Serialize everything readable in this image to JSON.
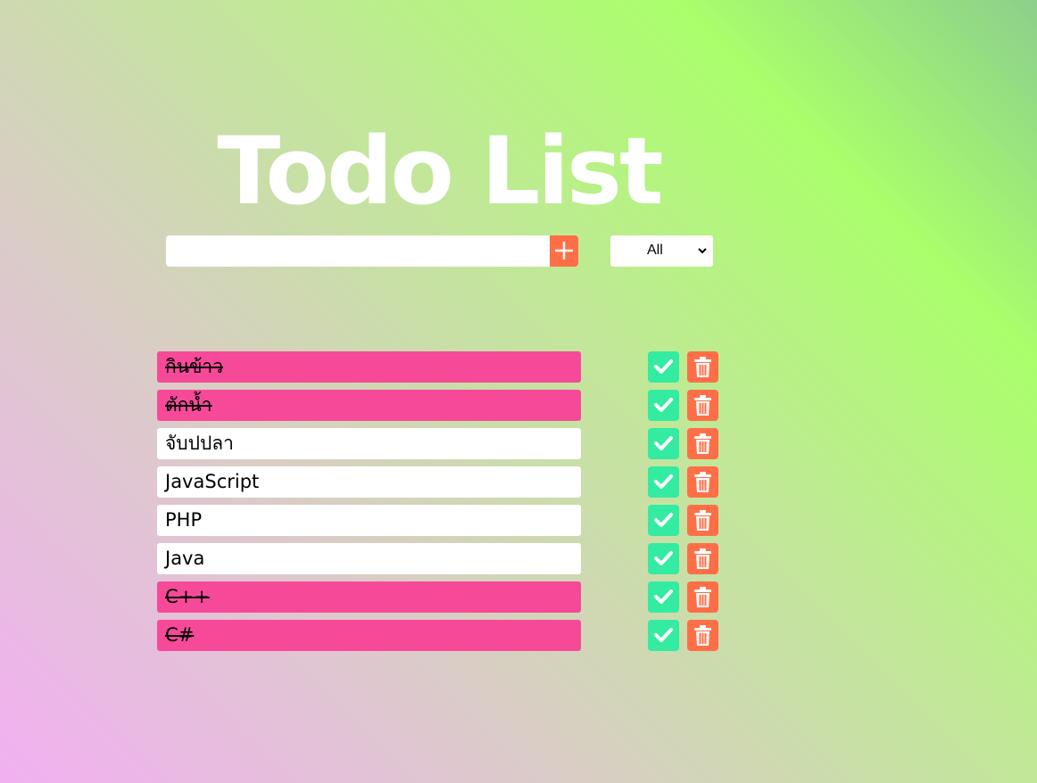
{
  "title": "Todo List",
  "add_form": {
    "input_value": "",
    "button_icon": "plus-icon"
  },
  "filter": {
    "selected": "All"
  },
  "todos": [
    {
      "text": "กินข้าว",
      "completed": true
    },
    {
      "text": "ตักน้ำ",
      "completed": true
    },
    {
      "text": "จับปปลา",
      "completed": false
    },
    {
      "text": "JavaScript",
      "completed": false
    },
    {
      "text": "PHP",
      "completed": false
    },
    {
      "text": "Java",
      "completed": false
    },
    {
      "text": "C++",
      "completed": true
    },
    {
      "text": "C#",
      "completed": true
    }
  ],
  "icons": {
    "complete": "check-icon",
    "delete": "trash-icon"
  },
  "colors": {
    "completed_item": "#f64a99",
    "complete_button": "#34eba2",
    "delete_button": "#ff6f47",
    "add_button": "#ff6f47"
  }
}
